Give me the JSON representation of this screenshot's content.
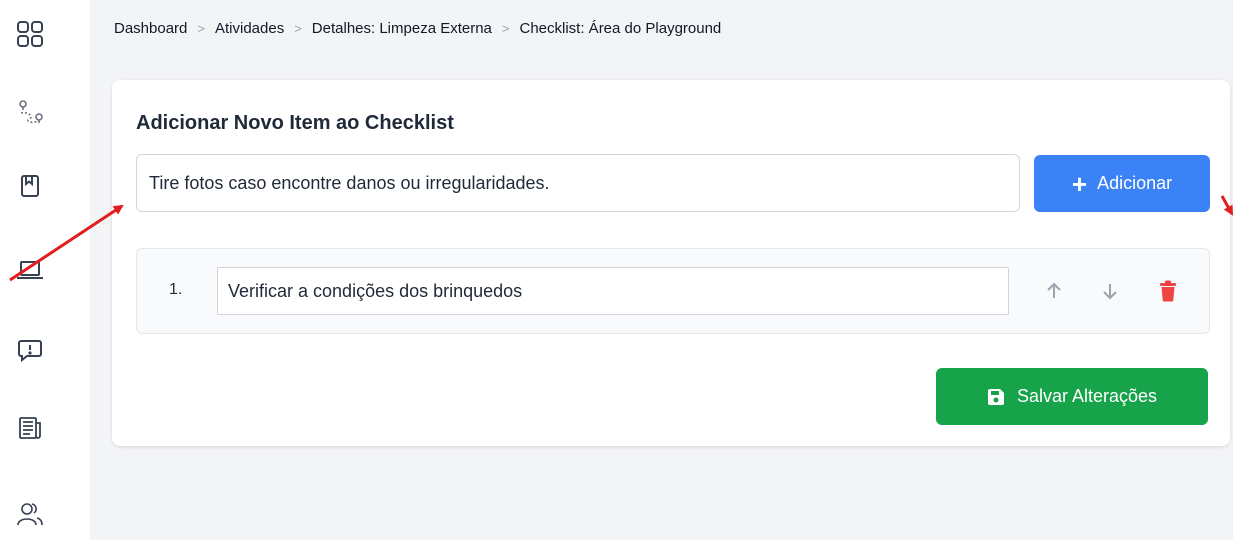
{
  "sidebar": {
    "items": [
      {
        "icon": "apps-grid-icon"
      },
      {
        "icon": "route-map-icon"
      },
      {
        "icon": "bookmark-icon"
      },
      {
        "icon": "laptop-icon"
      },
      {
        "icon": "alert-chat-icon"
      },
      {
        "icon": "newspaper-icon"
      },
      {
        "icon": "users-icon"
      }
    ]
  },
  "breadcrumb": {
    "items": [
      "Dashboard",
      "Atividades",
      "Detalhes: Limpeza Externa",
      "Checklist: Área do Playground"
    ],
    "separator": ">"
  },
  "card": {
    "title": "Adicionar Novo Item ao Checklist",
    "new_item_value": "Tire fotos caso encontre danos ou irregularidades.",
    "add_button_label": "Adicionar",
    "items": [
      {
        "index": "1.",
        "text": "Verificar a condições dos brinquedos"
      }
    ],
    "save_button_label": "Salvar Alterações"
  },
  "colors": {
    "primary": "#3b82f6",
    "success": "#16a34a",
    "danger": "#ef4444",
    "annotation": "#e11d1d"
  }
}
